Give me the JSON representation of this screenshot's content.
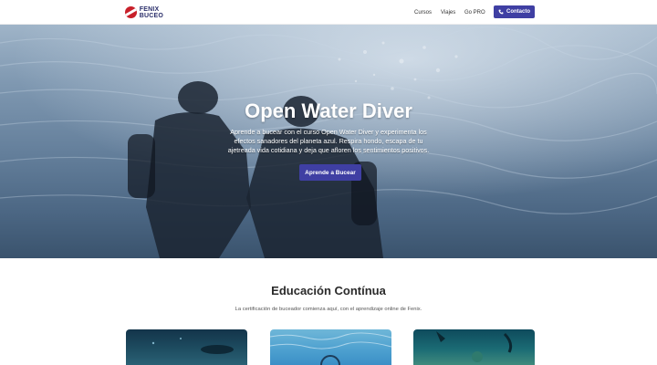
{
  "header": {
    "logo_line1": "FENIX",
    "logo_line2": "BUCEO",
    "nav": [
      "Cursos",
      "Viajes",
      "Go PRO"
    ],
    "contact_label": "Contacto"
  },
  "hero": {
    "title": "Open Water Diver",
    "description": "Aprende a bucear con el curso Open Water Diver y experimenta los efectos sanadores del planeta azul. Respira hondo, escapa de tu ajetreada vida cotidiana y deja que afloren los sentimientos positivos.",
    "cta_label": "Aprende a Bucear"
  },
  "education": {
    "title": "Educación Contínua",
    "subtitle": "La certificación de buceador comienza aquí, con el aprendizaje online de Fenix."
  },
  "colors": {
    "brand": "#3f3fa3",
    "logo_red": "#c8202a",
    "logo_navy": "#2b2f6b"
  },
  "icons": [
    "phone-icon"
  ]
}
